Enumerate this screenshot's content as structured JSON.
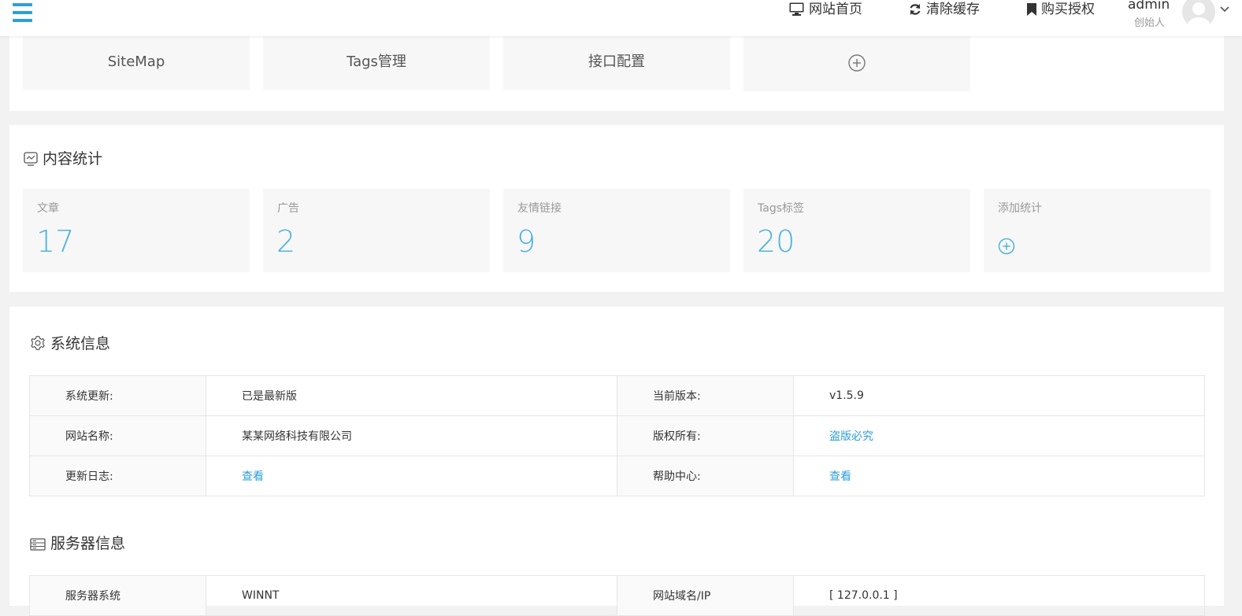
{
  "header": {
    "links": {
      "home": "网站首页",
      "clear_cache": "清除缓存",
      "buy_license": "购买授权"
    },
    "user": {
      "name": "admin",
      "role": "创始人"
    }
  },
  "quick_buttons": [
    "SiteMap",
    "Tags管理",
    "接口配置"
  ],
  "content_stats": {
    "title": "内容统计",
    "items": [
      {
        "label": "文章",
        "value": "17"
      },
      {
        "label": "广告",
        "value": "2"
      },
      {
        "label": "友情链接",
        "value": "9"
      },
      {
        "label": "Tags标签",
        "value": "20"
      }
    ],
    "add_label": "添加统计"
  },
  "system_info": {
    "title": "系统信息",
    "rows": [
      {
        "k1": "系统更新:",
        "v1": "已是最新版",
        "k2": "当前版本:",
        "v2": "v1.5.9"
      },
      {
        "k1": "网站名称:",
        "v1": "某某网络科技有限公司",
        "k2": "版权所有:",
        "v2": "盗版必究"
      },
      {
        "k1": "更新日志:",
        "v1": "查看",
        "k2": "帮助中心:",
        "v2": "查看"
      }
    ]
  },
  "server_info": {
    "title": "服务器信息",
    "rows": [
      {
        "k1": "服务器系统",
        "v1": "WINNT",
        "k2": "网站域名/IP",
        "v2": "[ 127.0.0.1 ]"
      }
    ]
  },
  "colors": {
    "accent": "#2d9fd9",
    "stat_number": "#4fb3e0",
    "page_bg": "#f2f2f2"
  }
}
